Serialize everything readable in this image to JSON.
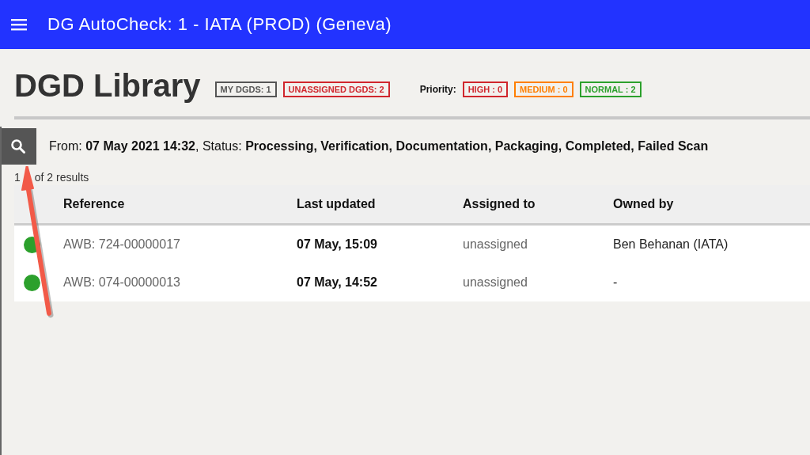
{
  "app_bar": {
    "title": "DG AutoCheck: 1 - IATA (PROD) (Geneva)"
  },
  "page": {
    "title": "DGD Library",
    "counters": [
      {
        "label": "MY DGDS: 1",
        "color": "#555555"
      },
      {
        "label": "UNASSIGNED DGDS: 2",
        "color": "#d0262d"
      }
    ],
    "priority_label": "Priority:",
    "priorities": [
      {
        "label": "HIGH : 0",
        "color": "#d0262d"
      },
      {
        "label": "MEDIUM : 0",
        "color": "#ff7f00"
      },
      {
        "label": "NORMAL : 2",
        "color": "#2ca02c"
      }
    ]
  },
  "filter": {
    "summary": "From: **07 May 2021 14:32**,  Status: **Processing, Verification, Documentation, Packaging, Completed, Failed Scan**"
  },
  "results_count": {
    "start": "1",
    "rest": "of 2 results"
  },
  "table": {
    "columns": [
      "Reference",
      "Last updated",
      "Assigned to",
      "Owned by"
    ],
    "rows": [
      {
        "color": "#2ca02c",
        "reference": "AWB: 724-00000017",
        "last_updated": "07 May, 15:09",
        "assigned_to": "unassigned",
        "owned_by": "Ben Behanan (IATA)"
      },
      {
        "color": "#2ca02c",
        "reference": "AWB: 074-00000013",
        "last_updated": "07 May, 14:52",
        "assigned_to": "unassigned",
        "owned_by": "-"
      }
    ]
  }
}
